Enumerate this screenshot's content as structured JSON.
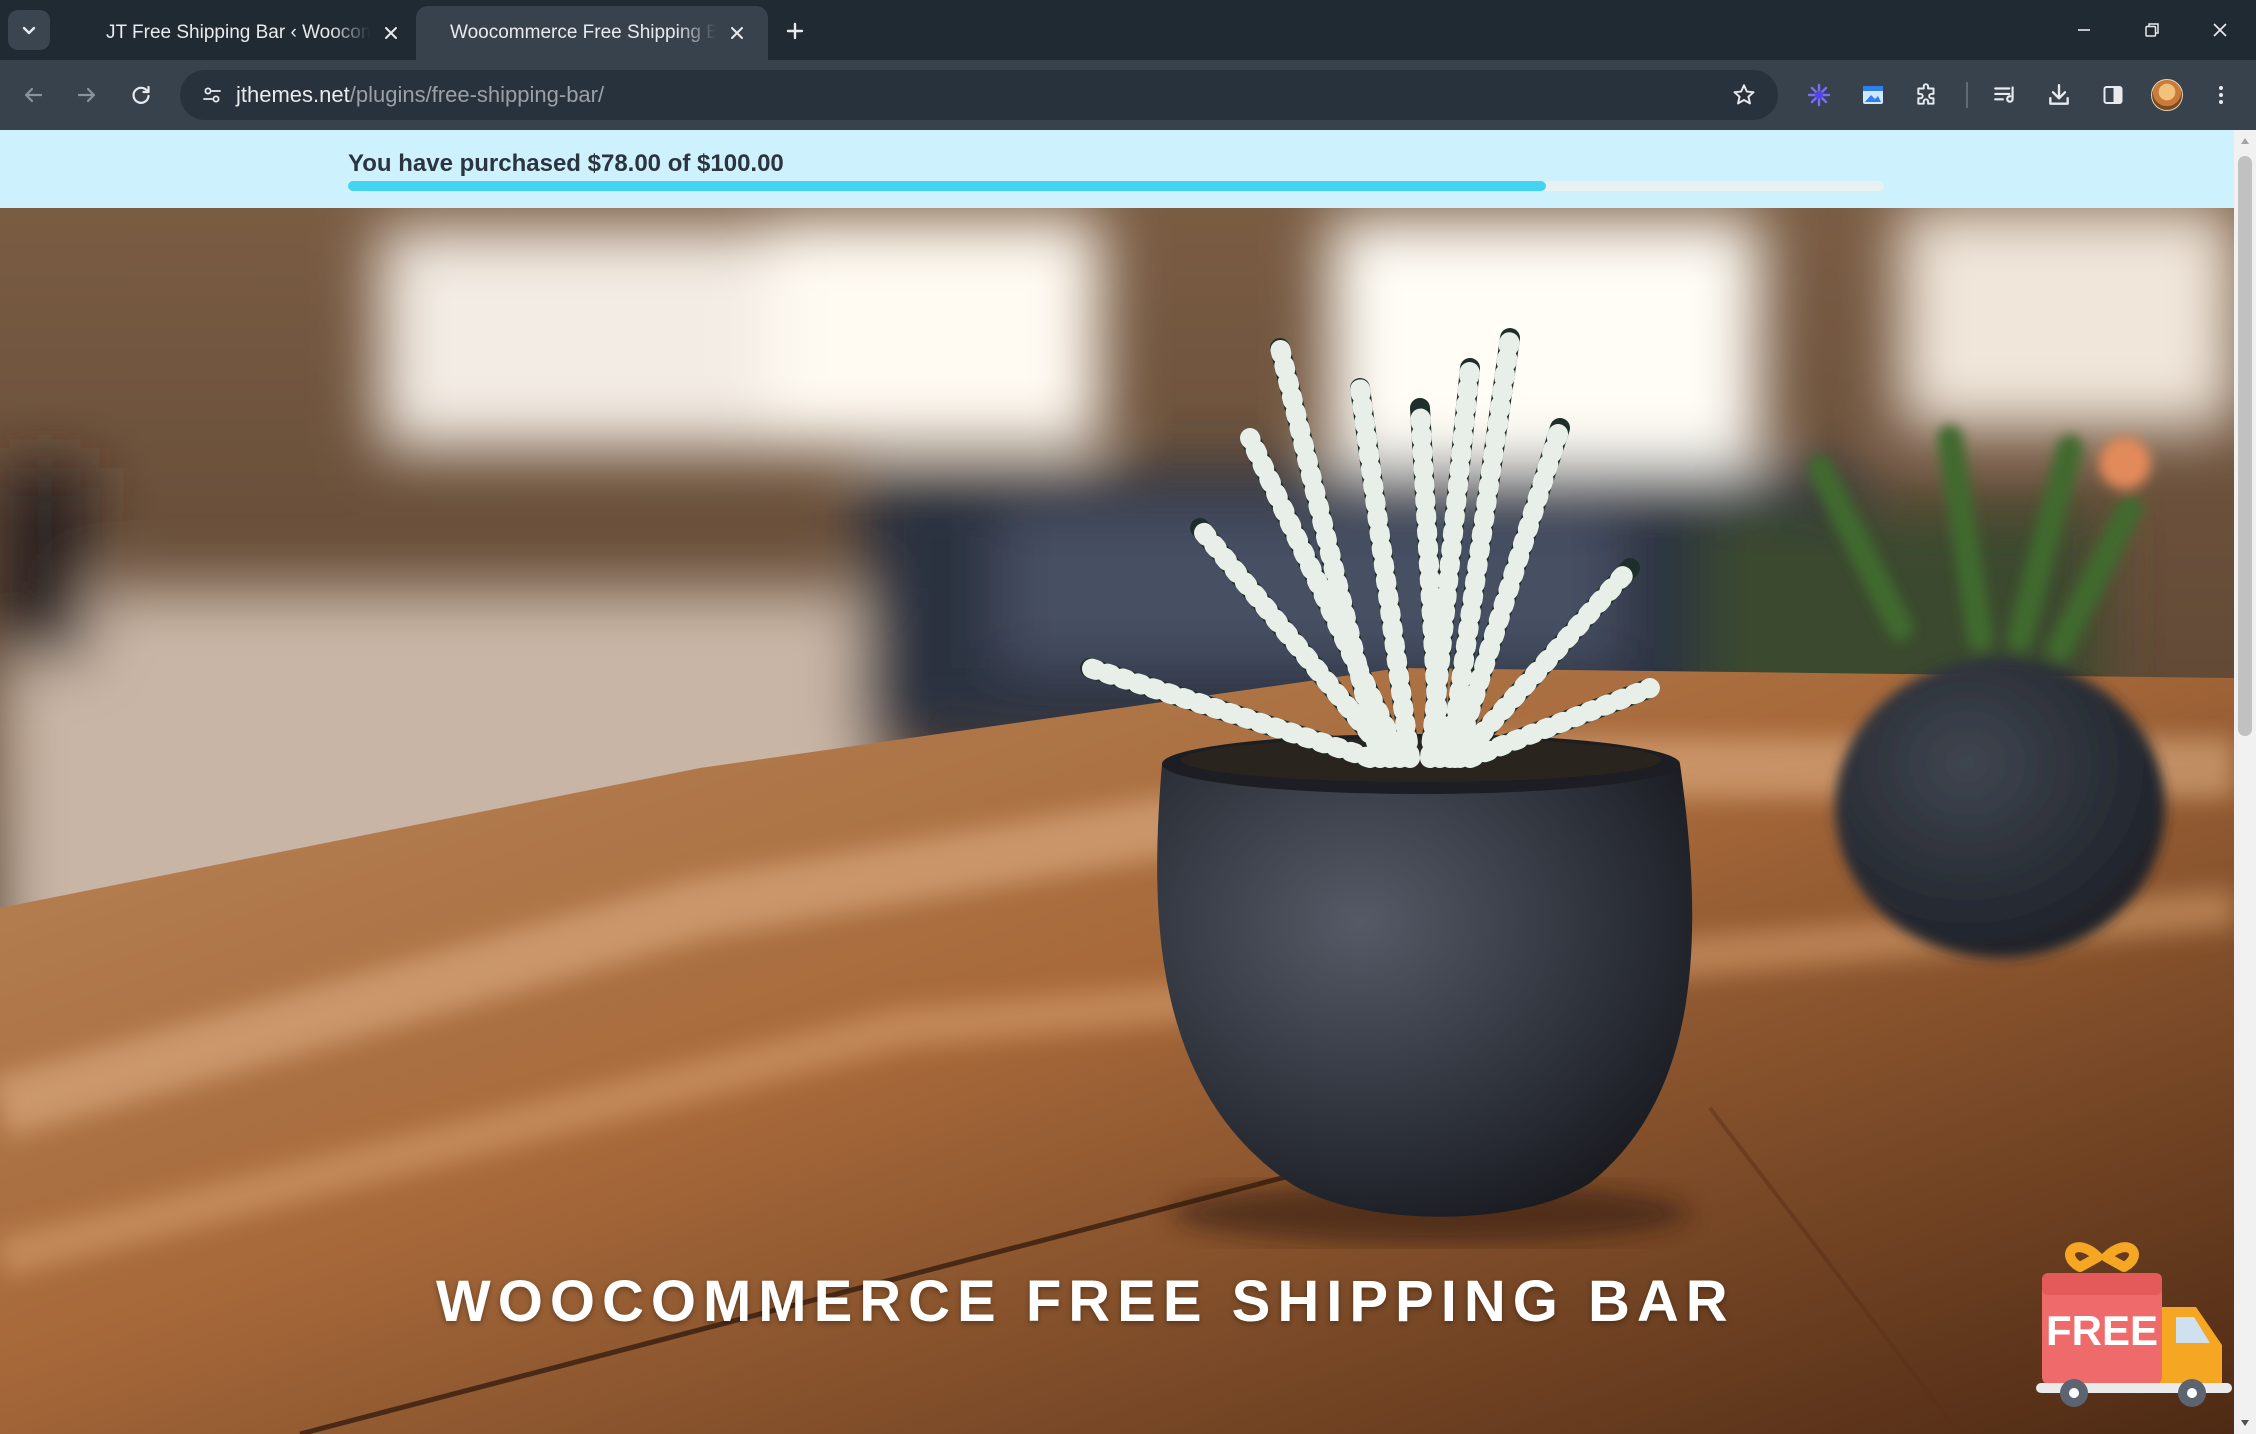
{
  "tabs": [
    {
      "title": "JT Free Shipping Bar ‹ Woocommerce",
      "active": false
    },
    {
      "title": "Woocommerce Free Shipping Bar",
      "active": true
    }
  ],
  "address_bar": {
    "host": "jthemes.net",
    "path": "/plugins/free-shipping-bar/"
  },
  "shipping_bar": {
    "message": "You have purchased $78.00 of $100.00",
    "progress_percent": 78,
    "fill_color": "#45d3f2",
    "background_color": "#cdf2fe"
  },
  "hero": {
    "title": "WOOCOMMERCE FREE SHIPPING BAR"
  },
  "badge": {
    "label": "FREE"
  },
  "icons": {
    "tab_search": "chevron-down-icon",
    "tab_close": "close-icon",
    "new_tab": "plus-icon",
    "back": "arrow-left-icon",
    "forward": "arrow-right-icon",
    "reload": "reload-icon",
    "site_info": "tune-icon",
    "bookmark": "star-icon",
    "extensions": "puzzle-icon",
    "reading_list": "reading-list-icon",
    "downloads": "download-icon",
    "side_panel": "side-panel-icon",
    "menu": "kebab-menu-icon"
  }
}
